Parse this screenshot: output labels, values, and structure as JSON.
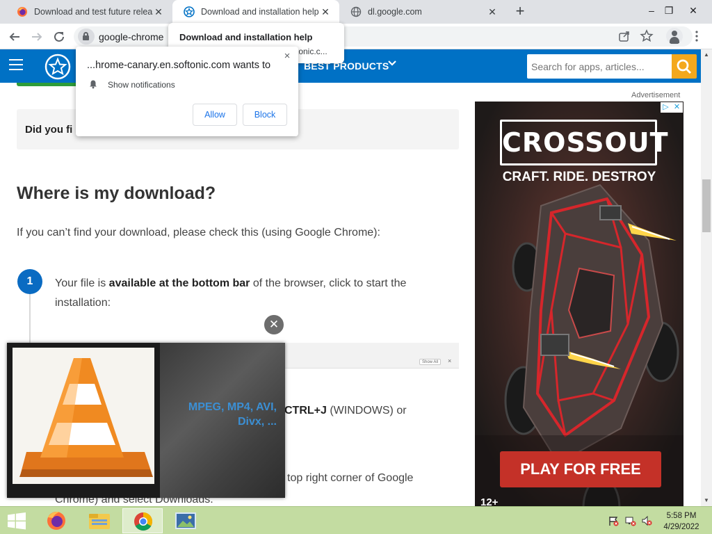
{
  "browser": {
    "tabs": [
      {
        "title": "Download and test future releases",
        "active": false,
        "favicon": "firefox-icon"
      },
      {
        "title": "Download and installation help",
        "active": true,
        "favicon": "softonic-icon"
      },
      {
        "title": "dl.google.com",
        "active": false,
        "favicon": "globe-icon"
      }
    ],
    "new_tab": "+",
    "window_controls": {
      "minimize": "–",
      "maximize": "❐",
      "close": "✕"
    },
    "url": "google-chrome"
  },
  "hover_card": {
    "title": "Download and installation help",
    "domain": "tonic.c..."
  },
  "notification_prompt": {
    "title": "...hrome-canary.en.softonic.com wants to",
    "permission": "Show notifications",
    "allow_label": "Allow",
    "block_label": "Block",
    "close": "×"
  },
  "site_header": {
    "menu_label": "BEST PRODUCTS",
    "search_placeholder": "Search for apps, articles...",
    "accent_color": "#0071c5",
    "search_button_color": "#f4a81d"
  },
  "content": {
    "did_you_text": "Did you fi",
    "heading": "Where is my download?",
    "intro": "If you can’t find your download, please check this (using Google Chrome):",
    "step1": {
      "number": "1",
      "text_before": "Your file is ",
      "text_bold": "available at the bottom bar",
      "text_after": " of the browser, click to start the installation:"
    },
    "download_bar": {
      "show_all": "Show All",
      "close": "×"
    },
    "fragment_bold": "CTRL+J",
    "fragment_after": " (WINDOWS) or",
    "fragment2": "top right corner of Google",
    "fragment3": "Chrome) and select Downloads."
  },
  "ad": {
    "label": "Advertisement",
    "brand": "CROSSOUT",
    "tagline": "CRAFT. RIDE. DESTROY",
    "cta": "PLAY FOR FREE",
    "rating": "12+"
  },
  "video": {
    "overlay_text": "MPEG, MP4, AVI, Divx, ..."
  },
  "taskbar": {
    "time": "5:58 PM",
    "date": "4/29/2022"
  }
}
